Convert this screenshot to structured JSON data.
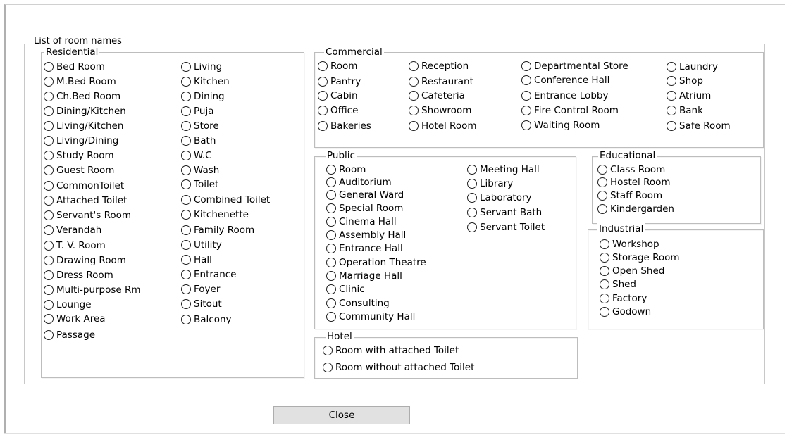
{
  "dialog": {
    "group_title": "List of room names",
    "close_label": "Close"
  },
  "residential": {
    "title": "Residential",
    "col1": [
      "Bed Room",
      "M.Bed Room",
      "Ch.Bed Room",
      "Dining/Kitchen",
      "Living/Kitchen",
      "Living/Dining",
      "Study Room",
      "Guest Room",
      "CommonToilet",
      "Attached Toilet",
      "Servant's Room",
      "Verandah",
      "T. V. Room",
      "Drawing Room",
      "Dress Room",
      "Multi-purpose Rm",
      "Lounge",
      "Work Area",
      "Passage"
    ],
    "col2": [
      "Living",
      "Kitchen",
      "Dining",
      "Puja",
      "Store",
      "Bath",
      "W.C",
      "Wash",
      "Toilet",
      "Combined Toilet",
      "Kitchenette",
      "Family Room",
      "Utility",
      "Hall",
      "Entrance",
      "Foyer",
      "Sitout",
      "Balcony"
    ]
  },
  "commercial": {
    "title": "Commercial",
    "col1": [
      "Room",
      "Pantry",
      "Cabin",
      "Office",
      "Bakeries"
    ],
    "col2": [
      "Reception",
      "Restaurant",
      "Cafeteria",
      "Showroom",
      "Hotel Room"
    ],
    "col3": [
      "Departmental Store",
      "Conference Hall",
      "Entrance Lobby",
      "Fire Control Room",
      "Waiting Room"
    ],
    "col4": [
      "Laundry",
      "Shop",
      "Atrium",
      "Bank",
      "Safe Room"
    ]
  },
  "public": {
    "title": "Public",
    "col1": [
      "Room",
      "Auditorium",
      "General Ward",
      "Special Room",
      "Cinema Hall",
      "Assembly Hall",
      "Entrance Hall",
      "Operation Theatre",
      "Marriage Hall",
      "Clinic",
      "Consulting",
      "Community Hall"
    ],
    "col2": [
      "Meeting Hall",
      "Library",
      "Laboratory",
      "Servant Bath",
      "Servant Toilet"
    ]
  },
  "educational": {
    "title": "Educational",
    "items": [
      "Class Room",
      "Hostel Room",
      "Staff Room",
      "Kindergarden"
    ]
  },
  "industrial": {
    "title": "Industrial",
    "items": [
      "Workshop",
      "Storage Room",
      "Open Shed",
      "Shed",
      "Factory",
      "Godown"
    ]
  },
  "hotel": {
    "title": "Hotel",
    "items": [
      "Room with attached Toilet",
      "Room without attached Toilet"
    ]
  }
}
